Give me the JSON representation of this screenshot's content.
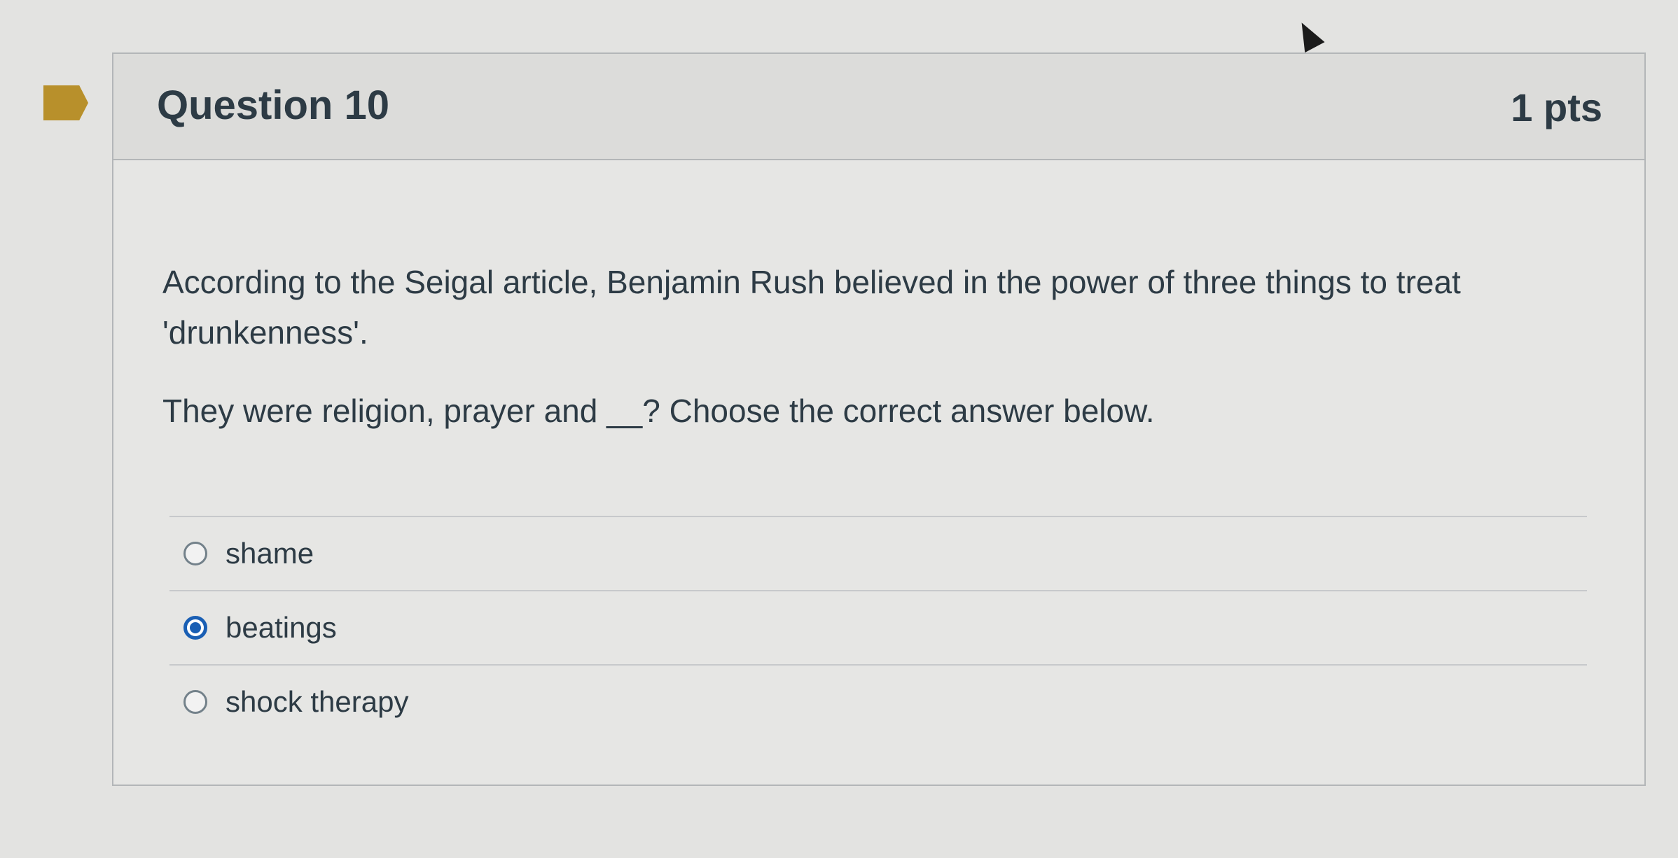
{
  "question": {
    "title": "Question 10",
    "points": "1 pts",
    "paragraphs": [
      "According to the Seigal article, Benjamin Rush believed in the power of three things to treat 'drunkenness'.",
      "They were religion, prayer and __? Choose the correct answer below."
    ]
  },
  "answers": [
    {
      "label": "shame",
      "selected": false
    },
    {
      "label": "beatings",
      "selected": true
    },
    {
      "label": "shock therapy",
      "selected": false
    }
  ],
  "colors": {
    "flag": "#b8902b",
    "selected_radio": "#1a5fb4",
    "text": "#2d3b45"
  }
}
